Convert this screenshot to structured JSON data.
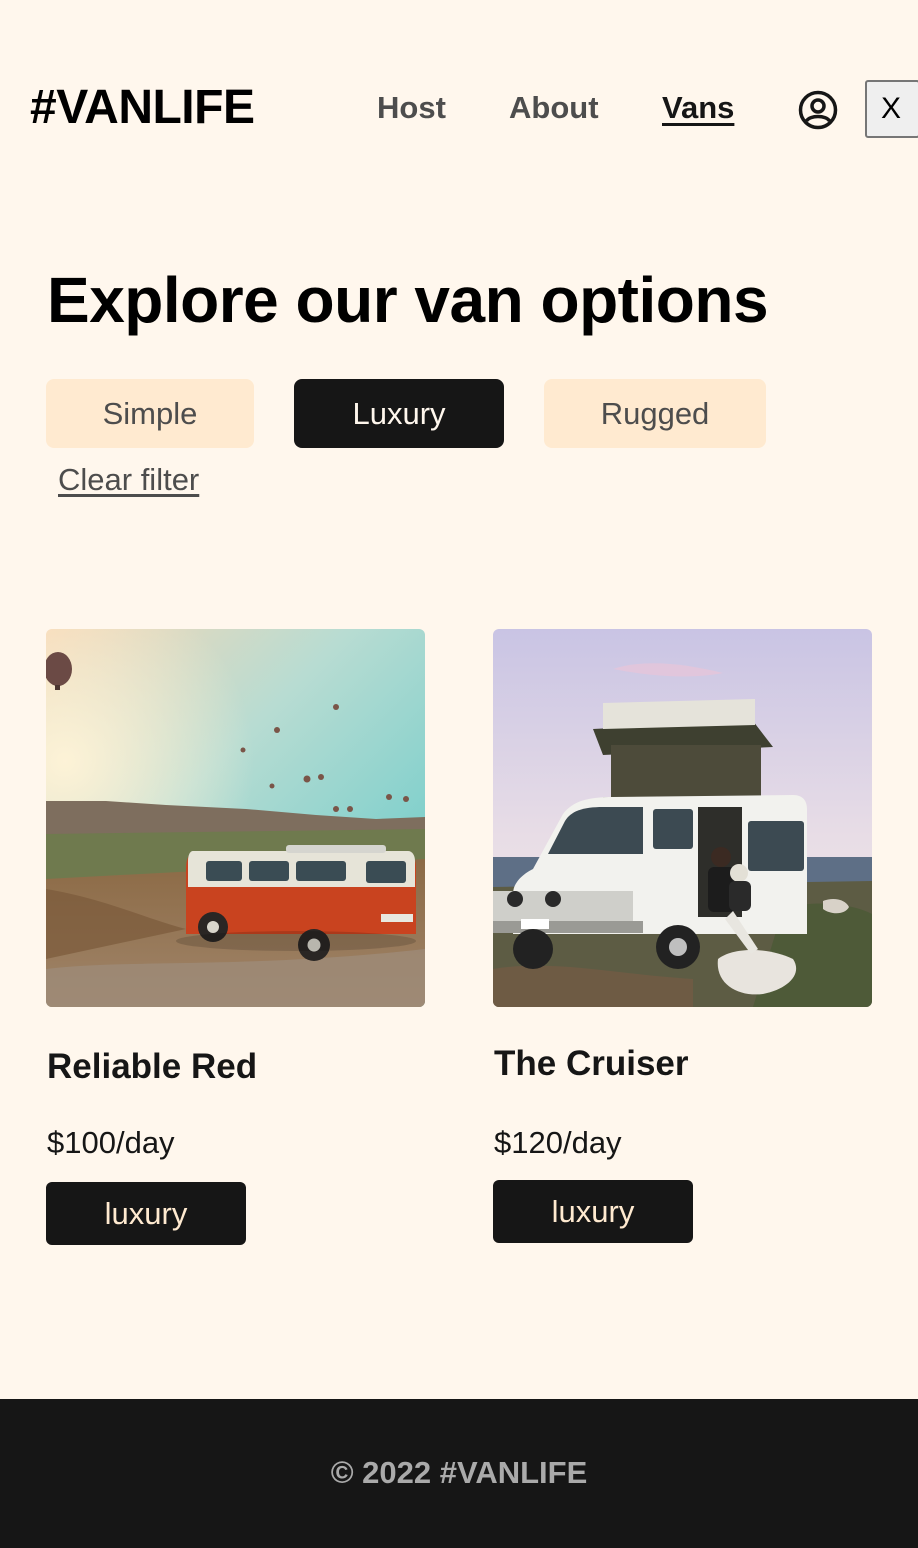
{
  "header": {
    "logo": "#VANLIFE",
    "nav": {
      "host": "Host",
      "about": "About",
      "vans": "Vans"
    },
    "close_label": "X",
    "icons": [
      "user-circle-icon"
    ]
  },
  "main": {
    "title": "Explore our van options",
    "filters": [
      {
        "label": "Simple",
        "selected": false
      },
      {
        "label": "Luxury",
        "selected": true
      },
      {
        "label": "Rugged",
        "selected": false
      }
    ],
    "clear_filter": "Clear filter",
    "vans": [
      {
        "name": "Reliable Red",
        "price": "$100/day",
        "type": "luxury"
      },
      {
        "name": "The Cruiser",
        "price": "$120/day",
        "type": "luxury"
      }
    ]
  },
  "footer": {
    "text": "© 2022 #VANLIFE"
  },
  "colors": {
    "background": "#FFF7ED",
    "filter_bg": "#FFEAD0",
    "dark": "#161616",
    "footer_text": "#AAAAAA"
  }
}
